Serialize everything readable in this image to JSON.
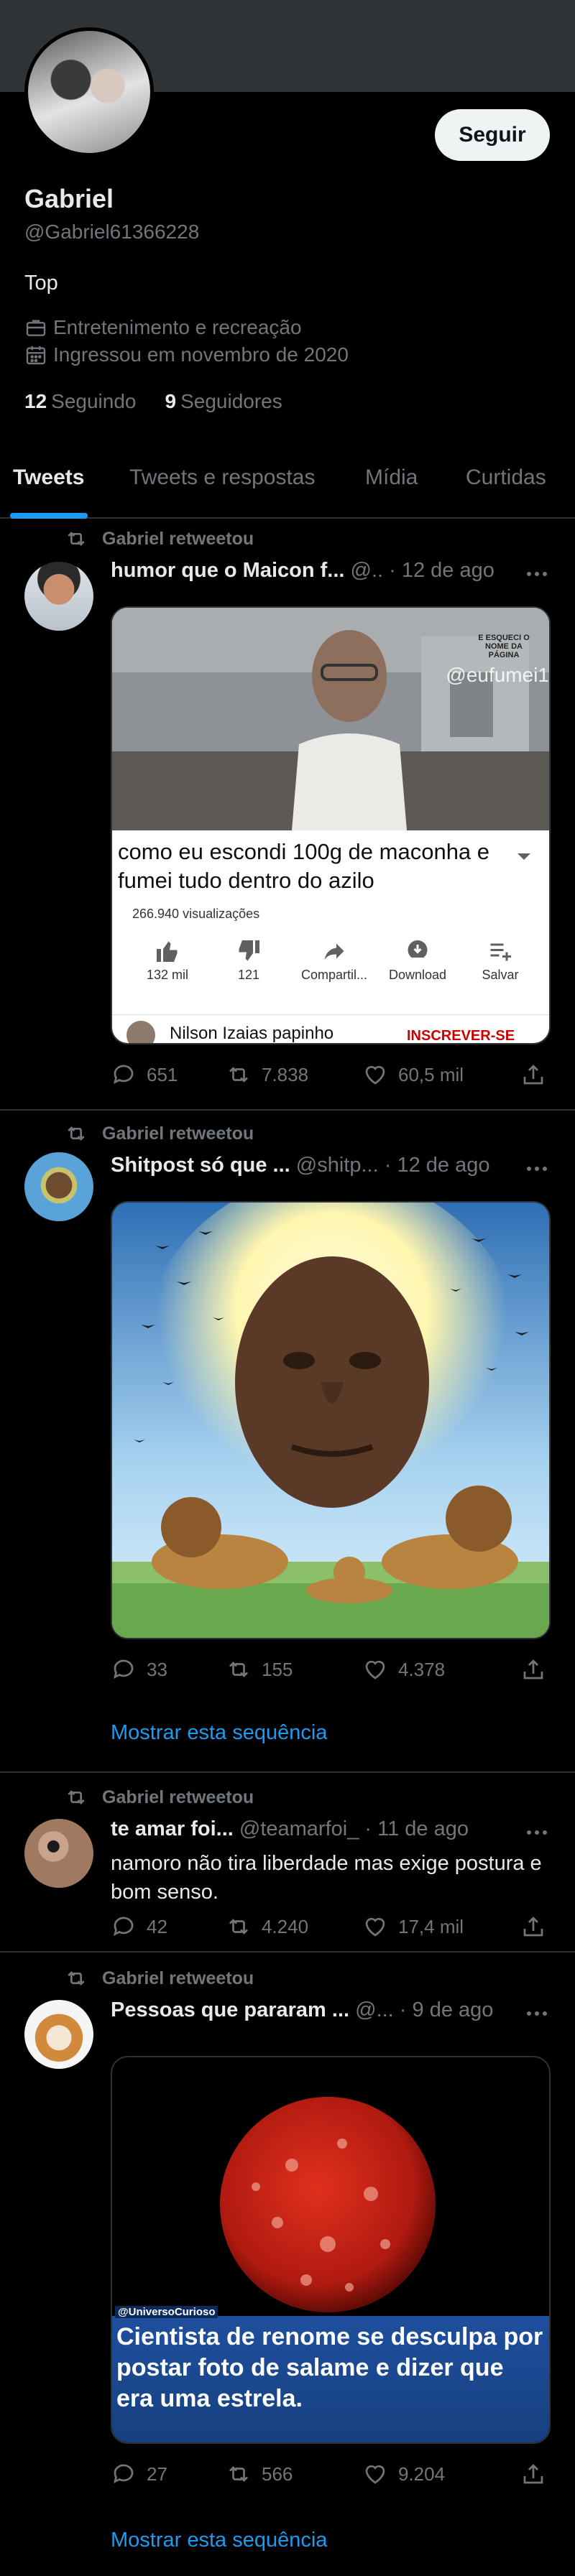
{
  "profile": {
    "follow_label": "Seguir",
    "name": "Gabriel",
    "handle": "@Gabriel61366228",
    "bio": "Top",
    "category": "Entretenimento e recreação",
    "joined": "Ingressou em novembro de 2020",
    "following_count": "12",
    "following_label": "Seguindo",
    "followers_count": "9",
    "followers_label": "Seguidores"
  },
  "tabs": [
    "Tweets",
    "Tweets e respostas",
    "Mídia",
    "Curtidas"
  ],
  "retweet_label": "Gabriel retweetou",
  "show_thread_label": "Mostrar esta sequência",
  "tweets": [
    {
      "name": "humor que o Maicon f...",
      "handle": "@..",
      "time": "· 12 de ago",
      "media": {
        "watermark": "@eufumei1",
        "logo_text": "E ESQUECI O NOME DA PÁGINA",
        "video_title": "como eu escondi 100g de maconha e fumei tudo dentro do azilo",
        "views": "266.940 visualizações",
        "btn_like": "132 mil",
        "btn_dislike": "121",
        "btn_share": "Compartil...",
        "btn_download": "Download",
        "btn_save": "Salvar",
        "channel": "Nilson Izaias papinho",
        "subscribe": "INSCREVER-SE"
      },
      "replies": "651",
      "retweets": "7.838",
      "likes": "60,5 mil"
    },
    {
      "name": "Shitpost só que ...",
      "handle": "@shitp...",
      "time": "· 12 de ago",
      "replies": "33",
      "retweets": "155",
      "likes": "4.378"
    },
    {
      "name": "te amar foi...",
      "handle": "@teamarfoi_",
      "time": "· 11 de ago",
      "text": "namoro não tira liberdade mas exige postura e bom senso.",
      "replies": "42",
      "retweets": "4.240",
      "likes": "17,4 mil"
    },
    {
      "name": "Pessoas que pararam ...",
      "handle": "@...",
      "time": "· 9 de ago",
      "media": {
        "source": "@UniversoCurioso",
        "caption": "Cientista de renome se desculpa por postar foto de salame e dizer que era uma estrela."
      },
      "replies": "27",
      "retweets": "566",
      "likes": "9.204"
    }
  ]
}
